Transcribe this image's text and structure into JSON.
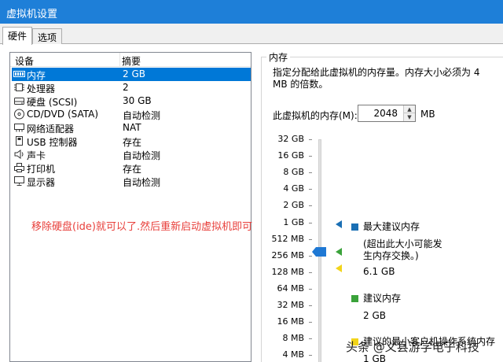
{
  "window": {
    "title": "虚拟机设置"
  },
  "tabs": [
    {
      "label": "硬件"
    },
    {
      "label": "选项"
    }
  ],
  "device_list": {
    "headers": {
      "device": "设备",
      "summary": "摘要"
    },
    "rows": [
      {
        "name": "内存",
        "summary": "2 GB",
        "icon": "memory-icon",
        "selected": true
      },
      {
        "name": "处理器",
        "summary": "2",
        "icon": "processor-icon"
      },
      {
        "name": "硬盘 (SCSI)",
        "summary": "30 GB",
        "icon": "hard-disk-icon"
      },
      {
        "name": "CD/DVD (SATA)",
        "summary": "自动检测",
        "icon": "cd-dvd-icon"
      },
      {
        "name": "网络适配器",
        "summary": "NAT",
        "icon": "network-adapter-icon"
      },
      {
        "name": "USB 控制器",
        "summary": "存在",
        "icon": "usb-icon"
      },
      {
        "name": "声卡",
        "summary": "自动检测",
        "icon": "sound-card-icon"
      },
      {
        "name": "打印机",
        "summary": "存在",
        "icon": "printer-icon"
      },
      {
        "name": "显示器",
        "summary": "自动检测",
        "icon": "display-icon"
      }
    ]
  },
  "annotation": "移除硬盘(ide)就可以了.然后重新启动虚拟机即可",
  "memory": {
    "group_title": "内存",
    "description": "指定分配给此虚拟机的内存量。内存大小必须为 4 MB 的倍数。",
    "field_label": "此虚拟机的内存(M):",
    "value": "2048",
    "unit": "MB",
    "scale_ticks": [
      "32 GB",
      "16 GB",
      "8 GB",
      "4 GB",
      "2 GB",
      "1 GB",
      "512 MB",
      "256 MB",
      "128 MB",
      "64 MB",
      "32 MB",
      "16 MB",
      "8 MB",
      "4 MB"
    ],
    "selected_tick": "2 GB",
    "legend": {
      "max_title": "最大建议内存",
      "max_note": "(超出此大小可能发生内存交换。)",
      "max_value": "6.1 GB",
      "rec_title": "建议内存",
      "rec_value": "2 GB",
      "min_title": "建议的最小客户机操作系统内存",
      "min_value": "1 GB"
    },
    "colors": {
      "max": "#1a6fb4",
      "recommended": "#3aa23a",
      "minimum": "#f2d41a",
      "thumb": "#1e78d4"
    }
  },
  "watermark": "头条 @义县游学电子科技"
}
